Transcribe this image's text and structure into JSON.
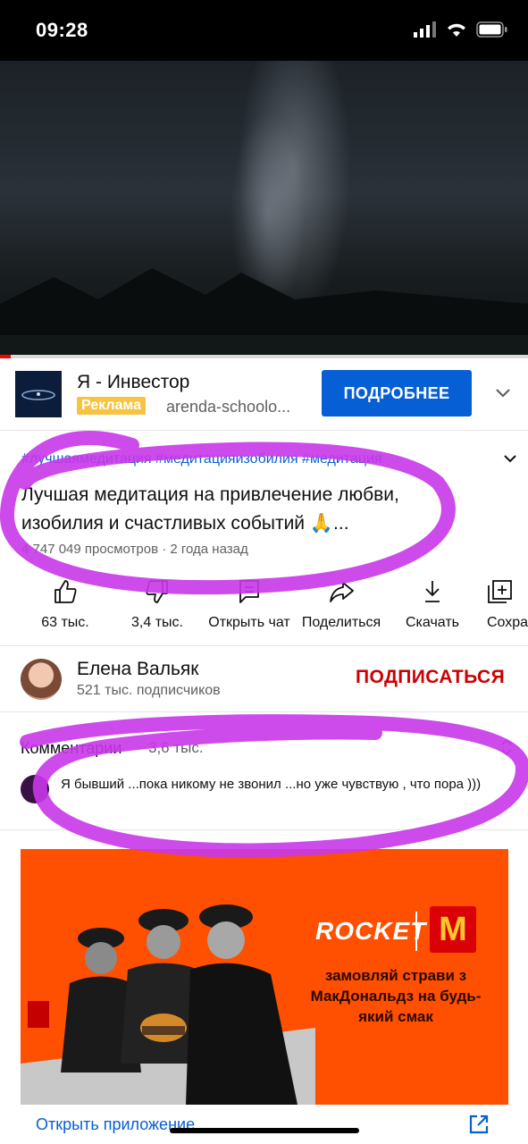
{
  "status_bar": {
    "time": "09:28"
  },
  "ad": {
    "title": "Я - Инвестор",
    "badge": "Реклама",
    "url": "arenda-schoolo...",
    "button": "ПОДРОБНЕЕ"
  },
  "video": {
    "hashtags": "#лучшаямедитация #медитацияизобилия #медитация",
    "title": "Лучшая медитация на привлечение любви, изобилия и счастливых событий 🙏...",
    "meta": "4 747 049 просмотров · 2 года назад",
    "progress": 0.02
  },
  "actions": [
    {
      "label": "63 тыс.",
      "icon": "like-icon"
    },
    {
      "label": "3,4 тыс.",
      "icon": "dislike-icon"
    },
    {
      "label": "Открыть чат",
      "icon": "chat-icon"
    },
    {
      "label": "Поделиться",
      "icon": "share-icon"
    },
    {
      "label": "Скачать",
      "icon": "download-icon"
    },
    {
      "label": "Сохра",
      "icon": "save-icon"
    }
  ],
  "channel": {
    "name": "Елена Вальяк",
    "subscribers": "521 тыс. подписчиков",
    "subscribe": "ПОДПИСАТЬСЯ"
  },
  "comments": {
    "label": "Комментарии",
    "count": "3,6 тыс.",
    "top_comment": "Я бывший ...пока никому не звонил ...но уже чувствую , что пора )))"
  },
  "promo": {
    "brand": "ROCKET",
    "logo_letter": "M",
    "text": "замовляй страви з МакДональдз на будь-який смак",
    "open_app": "Открыть приложение"
  },
  "colors": {
    "accent": "#065fd4",
    "subscribe": "#cc0000",
    "ad_badge": "#f6c343",
    "promo_bg": "#ff4f00",
    "scribble": "#c837e8"
  }
}
